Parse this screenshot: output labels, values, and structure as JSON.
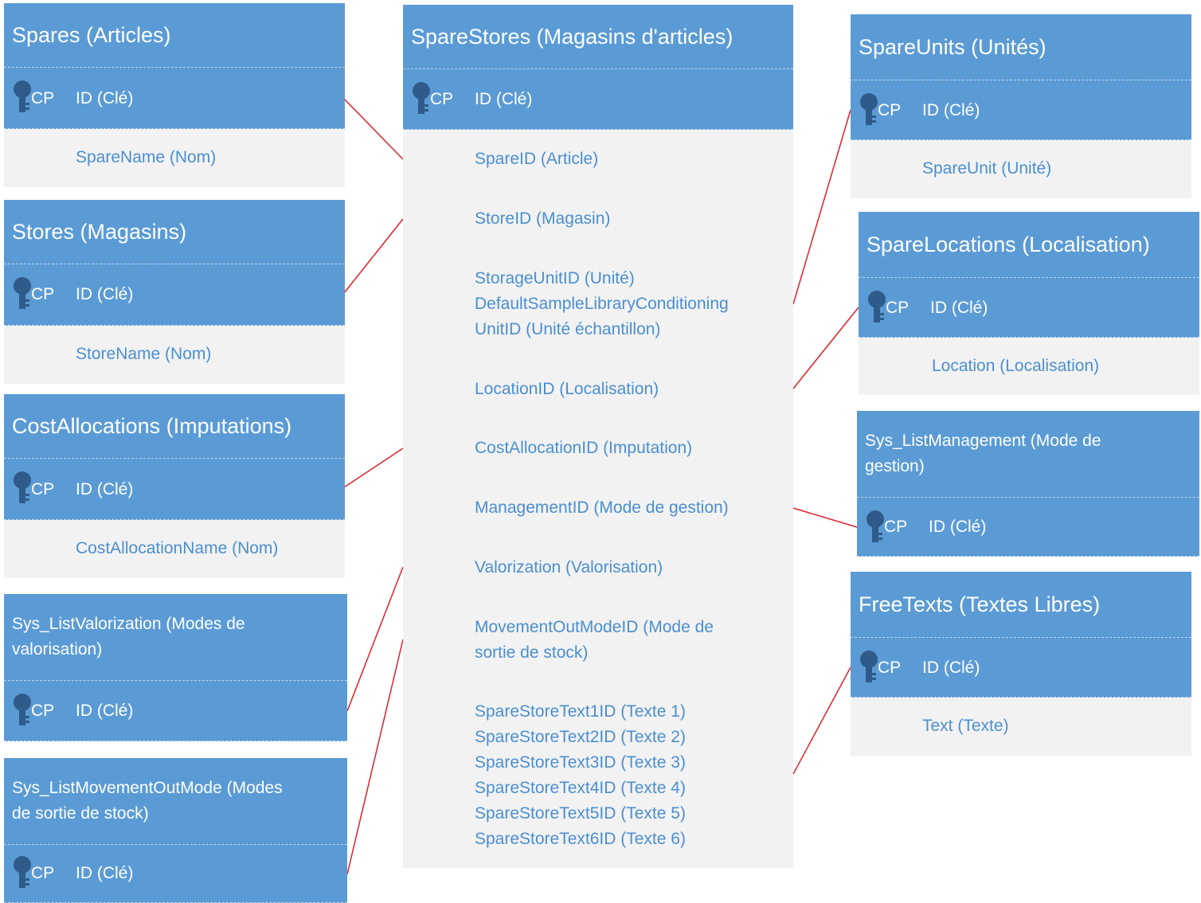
{
  "colors": {
    "header": "#5b9bd5",
    "body": "#f2f2f2",
    "field_text": "#4a8fd0",
    "connector": "#e0202a",
    "key_icon": "#2e5b8a"
  },
  "pk": {
    "badge": "CP",
    "label": "ID (Clé)",
    "icon": "key-icon"
  },
  "tables": {
    "spares": {
      "title": "Spares (Articles)",
      "fields": [
        "SpareName (Nom)"
      ]
    },
    "stores": {
      "title": "Stores (Magasins)",
      "fields": [
        "StoreName (Nom)"
      ]
    },
    "cost_allocations": {
      "title": "CostAllocations (Imputations)",
      "fields": [
        "CostAllocationName (Nom)"
      ]
    },
    "sys_list_valorization": {
      "title_line1": "Sys_ListValorization (Modes de",
      "title_line2": "valorisation)"
    },
    "sys_list_movement_out_mode": {
      "title_line1": "Sys_ListMovementOutMode (Modes",
      "title_line2": "de sortie de stock)"
    },
    "spare_stores": {
      "title": "SpareStores (Magasins d'articles)",
      "fields": [
        "SpareID (Article)",
        "StoreID (Magasin)",
        "StorageUnitID (Unité)",
        "DefaultSampleLibraryConditioning",
        "UnitID (Unité échantillon)",
        "LocationID (Localisation)",
        "CostAllocationID (Imputation)",
        "ManagementID (Mode de gestion)",
        "Valorization (Valorisation)",
        "MovementOutModeID (Mode de",
        "sortie de stock)",
        "SpareStoreText1ID (Texte 1)",
        "SpareStoreText2ID (Texte 2)",
        "SpareStoreText3ID (Texte 3)",
        "SpareStoreText4ID (Texte 4)",
        "SpareStoreText5ID (Texte 5)",
        "SpareStoreText6ID (Texte 6)"
      ]
    },
    "spare_units": {
      "title": "SpareUnits (Unités)",
      "fields": [
        "SpareUnit (Unité)"
      ]
    },
    "spare_locations": {
      "title": "SpareLocations (Localisation)",
      "fields": [
        "Location (Localisation)"
      ]
    },
    "sys_list_management": {
      "title_line1": "Sys_ListManagement (Mode de",
      "title_line2": "gestion)"
    },
    "free_texts": {
      "title": "FreeTexts (Textes Libres)",
      "fields": [
        "Text (Texte)"
      ]
    }
  }
}
